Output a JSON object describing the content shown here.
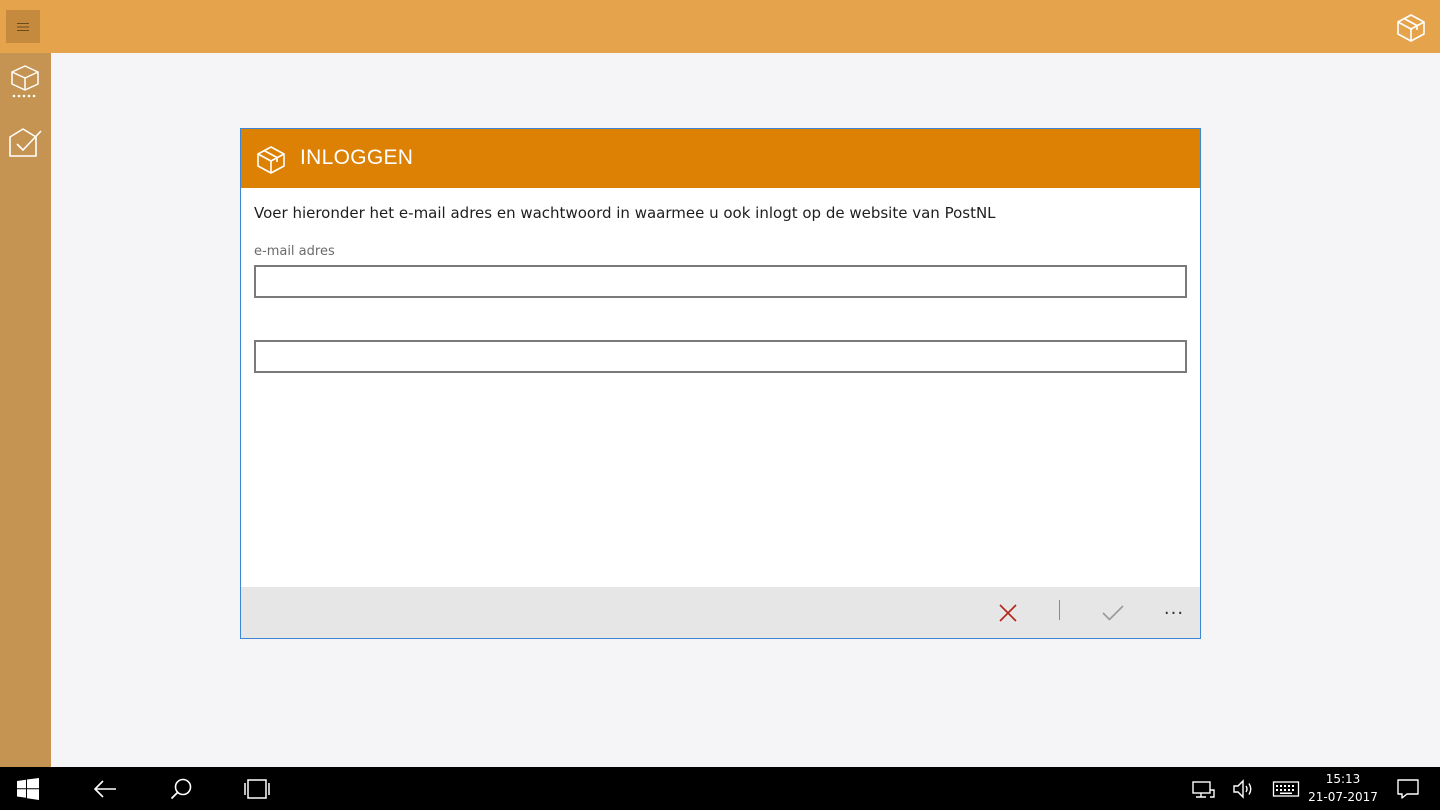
{
  "app": {
    "accent": "#e5a44b",
    "rail_color": "#c69452",
    "dialog_header_color": "#dc8103",
    "icons": {
      "menu": "hamburger-icon",
      "logo": "package-icon",
      "rail": [
        "package-tracking-icon",
        "send-package-icon"
      ]
    }
  },
  "dialog": {
    "title": "INLOGGEN",
    "instruction": "Voer hieronder het e-mail adres en wachtwoord in waarmee u ook inlogt op de website van PostNL",
    "email_label": "e-mail adres",
    "email_value": "",
    "password_value": "",
    "commands": {
      "cancel_icon": "close-icon",
      "confirm_icon": "checkmark-icon",
      "more_label": "···"
    }
  },
  "taskbar": {
    "time": "15:13",
    "date": "21-07-2017",
    "icons": [
      "windows-start-icon",
      "back-arrow-icon",
      "search-icon",
      "task-view-icon",
      "network-icon",
      "volume-icon",
      "keyboard-icon",
      "notifications-icon"
    ]
  }
}
